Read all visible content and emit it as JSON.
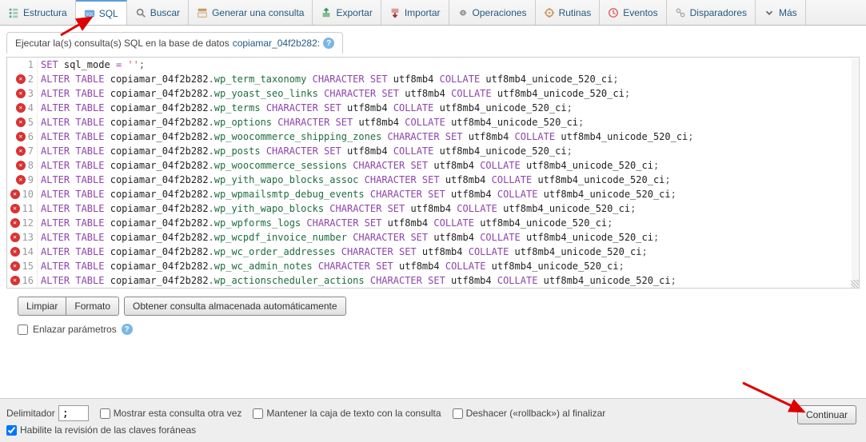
{
  "tabs": [
    {
      "label": "Estructura",
      "icon": "structure"
    },
    {
      "label": "SQL",
      "icon": "sql",
      "active": true
    },
    {
      "label": "Buscar",
      "icon": "search"
    },
    {
      "label": "Generar una consulta",
      "icon": "query"
    },
    {
      "label": "Exportar",
      "icon": "export"
    },
    {
      "label": "Importar",
      "icon": "import"
    },
    {
      "label": "Operaciones",
      "icon": "operations"
    },
    {
      "label": "Rutinas",
      "icon": "routines"
    },
    {
      "label": "Eventos",
      "icon": "events"
    },
    {
      "label": "Disparadores",
      "icon": "triggers"
    },
    {
      "label": "Más",
      "icon": "more"
    }
  ],
  "subheader": {
    "prefix": "Ejecutar la(s) consulta(s) SQL en la base de datos ",
    "dbname": "copiamar_04f2b282:"
  },
  "code": [
    {
      "n": 1,
      "err": false,
      "segments": [
        [
          "kw",
          "SET"
        ],
        [
          "plain",
          " sql_mode "
        ],
        [
          "kw",
          "="
        ],
        [
          "plain",
          " "
        ],
        [
          "str",
          "''"
        ],
        [
          "col",
          ";"
        ]
      ]
    },
    {
      "n": 2,
      "err": true,
      "table": "wp_term_taxonomy"
    },
    {
      "n": 3,
      "err": true,
      "table": "wp_yoast_seo_links"
    },
    {
      "n": 4,
      "err": true,
      "table": "wp_terms"
    },
    {
      "n": 5,
      "err": true,
      "table": "wp_options"
    },
    {
      "n": 6,
      "err": true,
      "table": "wp_woocommerce_shipping_zones"
    },
    {
      "n": 7,
      "err": true,
      "table": "wp_posts"
    },
    {
      "n": 8,
      "err": true,
      "table": "wp_woocommerce_sessions"
    },
    {
      "n": 9,
      "err": true,
      "table": "wp_yith_wapo_blocks_assoc"
    },
    {
      "n": 10,
      "err": true,
      "table": "wp_wpmailsmtp_debug_events"
    },
    {
      "n": 11,
      "err": true,
      "table": "wp_yith_wapo_blocks"
    },
    {
      "n": 12,
      "err": true,
      "table": "wp_wpforms_logs"
    },
    {
      "n": 13,
      "err": true,
      "table": "wp_wcpdf_invoice_number"
    },
    {
      "n": 14,
      "err": true,
      "table": "wp_wc_order_addresses"
    },
    {
      "n": 15,
      "err": true,
      "table": "wp_wc_admin_notes"
    },
    {
      "n": 16,
      "err": true,
      "table": "wp_actionscheduler_actions"
    }
  ],
  "alter_template": {
    "kw1": "ALTER",
    "kw2": "TABLE",
    "db": "copiamar_04f2b282",
    "kw3": "CHARACTER",
    "kw4": "SET",
    "charset": "utf8mb4",
    "kw5": "COLLATE",
    "collate": "utf8mb4_unicode_520_ci"
  },
  "buttons": {
    "limpiar": "Limpiar",
    "formato": "Formato",
    "autosave": "Obtener consulta almacenada automáticamente"
  },
  "bind_params": "Enlazar parámetros",
  "footer": {
    "delim_label": "Delimitador",
    "delim_value": ";",
    "show_again": "Mostrar esta consulta otra vez",
    "keep_box": "Mantener la caja de texto con la consulta",
    "rollback": "Deshacer («rollback») al finalizar",
    "fk_check": "Habilite la revisión de las claves foráneas",
    "continuar": "Continuar"
  }
}
